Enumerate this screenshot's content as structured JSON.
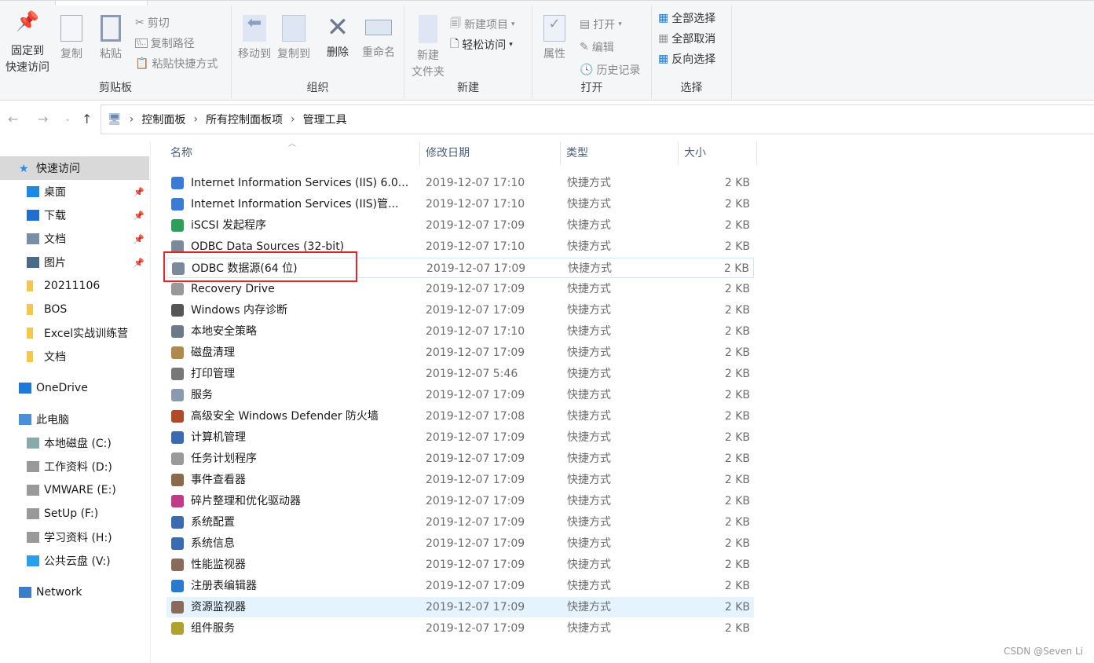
{
  "ribbon": {
    "clipboard": {
      "label": "剪贴板",
      "pin": "固定到\n快速访问",
      "copy": "复制",
      "paste": "粘贴",
      "cut": "剪切",
      "copy_path": "复制路径",
      "paste_shortcut": "粘贴快捷方式"
    },
    "organize": {
      "label": "组织",
      "move_to": "移动到",
      "copy_to": "复制到",
      "delete": "删除",
      "rename": "重命名"
    },
    "new": {
      "label": "新建",
      "new_folder": "新建\n文件夹",
      "new_item": "新建项目",
      "easy_access": "轻松访问"
    },
    "open": {
      "label": "打开",
      "properties": "属性",
      "open": "打开",
      "edit": "编辑",
      "history": "历史记录"
    },
    "select": {
      "label": "选择",
      "select_all": "全部选择",
      "select_none": "全部取消",
      "invert": "反向选择"
    }
  },
  "breadcrumb": [
    "控制面板",
    "所有控制面板项",
    "管理工具"
  ],
  "sidebar": [
    {
      "label": "快速访问",
      "icon": "star-icon",
      "color": "#2a8ae2"
    },
    {
      "label": "桌面",
      "icon": "desktop-icon",
      "pinned": true,
      "color": "#1e88e5"
    },
    {
      "label": "下载",
      "icon": "download-icon",
      "pinned": true,
      "color": "#1e6fd0"
    },
    {
      "label": "文档",
      "icon": "document-icon",
      "pinned": true,
      "color": "#7a8ea8"
    },
    {
      "label": "图片",
      "icon": "pictures-icon",
      "pinned": true,
      "color": "#4a6a8a"
    },
    {
      "label": "20211106",
      "icon": "folder-icon",
      "color": "#f2c94c"
    },
    {
      "label": "BOS",
      "icon": "folder-icon",
      "color": "#f2c94c"
    },
    {
      "label": "Excel实战训练营",
      "icon": "folder-icon",
      "color": "#f2c94c"
    },
    {
      "label": "文档",
      "icon": "folder-icon",
      "color": "#f2c94c"
    },
    {
      "label": "OneDrive",
      "icon": "cloud-icon",
      "color": "#1e78d7"
    },
    {
      "label": "此电脑",
      "icon": "computer-icon",
      "color": "#4a90d9"
    },
    {
      "label": "本地磁盘 (C:)",
      "icon": "drive-icon",
      "color": "#8aa"
    },
    {
      "label": "工作资料 (D:)",
      "icon": "drive-icon",
      "color": "#999"
    },
    {
      "label": "VMWARE (E:)",
      "icon": "drive-icon",
      "color": "#999"
    },
    {
      "label": "SetUp (F:)",
      "icon": "drive-icon",
      "color": "#999"
    },
    {
      "label": "学习资料 (H:)",
      "icon": "drive-icon",
      "color": "#999"
    },
    {
      "label": "公共云盘 (V:)",
      "icon": "cloud-drive-icon",
      "color": "#2aa0e8"
    },
    {
      "label": "Network",
      "icon": "network-icon",
      "color": "#3b7dc9"
    }
  ],
  "columns": {
    "name": "名称",
    "date": "修改日期",
    "type": "类型",
    "size": "大小"
  },
  "files": [
    {
      "name": "Internet Information Services (IIS) 6.0...",
      "date": "2019-12-07 17:10",
      "type": "快捷方式",
      "size": "2 KB",
      "color": "#3a7bd5"
    },
    {
      "name": "Internet Information Services (IIS)管...",
      "date": "2019-12-07 17:10",
      "type": "快捷方式",
      "size": "2 KB",
      "color": "#3a7bd5"
    },
    {
      "name": "iSCSI 发起程序",
      "date": "2019-12-07 17:09",
      "type": "快捷方式",
      "size": "2 KB",
      "color": "#2e9e5b"
    },
    {
      "name": "ODBC Data Sources (32-bit)",
      "date": "2019-12-07 17:10",
      "type": "快捷方式",
      "size": "2 KB",
      "color": "#7a8a9a"
    },
    {
      "name": "ODBC 数据源(64 位)",
      "date": "2019-12-07 17:09",
      "type": "快捷方式",
      "size": "2 KB",
      "color": "#7a8a9a"
    },
    {
      "name": "Recovery Drive",
      "date": "2019-12-07 17:09",
      "type": "快捷方式",
      "size": "2 KB",
      "color": "#999"
    },
    {
      "name": "Windows 内存诊断",
      "date": "2019-12-07 17:09",
      "type": "快捷方式",
      "size": "2 KB",
      "color": "#555"
    },
    {
      "name": "本地安全策略",
      "date": "2019-12-07 17:10",
      "type": "快捷方式",
      "size": "2 KB",
      "color": "#6a7a8a"
    },
    {
      "name": "磁盘清理",
      "date": "2019-12-07 17:09",
      "type": "快捷方式",
      "size": "2 KB",
      "color": "#b08a4a"
    },
    {
      "name": "打印管理",
      "date": "2019-12-07 5:46",
      "type": "快捷方式",
      "size": "2 KB",
      "color": "#777"
    },
    {
      "name": "服务",
      "date": "2019-12-07 17:09",
      "type": "快捷方式",
      "size": "2 KB",
      "color": "#8a9ab0"
    },
    {
      "name": "高级安全 Windows Defender 防火墙",
      "date": "2019-12-07 17:08",
      "type": "快捷方式",
      "size": "2 KB",
      "color": "#b04a2a"
    },
    {
      "name": "计算机管理",
      "date": "2019-12-07 17:09",
      "type": "快捷方式",
      "size": "2 KB",
      "color": "#3a6ab0"
    },
    {
      "name": "任务计划程序",
      "date": "2019-12-07 17:09",
      "type": "快捷方式",
      "size": "2 KB",
      "color": "#9a9a9a"
    },
    {
      "name": "事件查看器",
      "date": "2019-12-07 17:09",
      "type": "快捷方式",
      "size": "2 KB",
      "color": "#8a6a4a"
    },
    {
      "name": "碎片整理和优化驱动器",
      "date": "2019-12-07 17:09",
      "type": "快捷方式",
      "size": "2 KB",
      "color": "#c03a8a"
    },
    {
      "name": "系统配置",
      "date": "2019-12-07 17:09",
      "type": "快捷方式",
      "size": "2 KB",
      "color": "#3a6ab0"
    },
    {
      "name": "系统信息",
      "date": "2019-12-07 17:09",
      "type": "快捷方式",
      "size": "2 KB",
      "color": "#3a6ab0"
    },
    {
      "name": "性能监视器",
      "date": "2019-12-07 17:09",
      "type": "快捷方式",
      "size": "2 KB",
      "color": "#8a6a5a"
    },
    {
      "name": "注册表编辑器",
      "date": "2019-12-07 17:09",
      "type": "快捷方式",
      "size": "2 KB",
      "color": "#2a7ad0"
    },
    {
      "name": "资源监视器",
      "date": "2019-12-07 17:09",
      "type": "快捷方式",
      "size": "2 KB",
      "color": "#8a6a5a"
    },
    {
      "name": "组件服务",
      "date": "2019-12-07 17:09",
      "type": "快捷方式",
      "size": "2 KB",
      "color": "#b0a030"
    }
  ],
  "highlight_index": 4,
  "hover_index": 20,
  "watermark": "CSDN @Seven Li"
}
